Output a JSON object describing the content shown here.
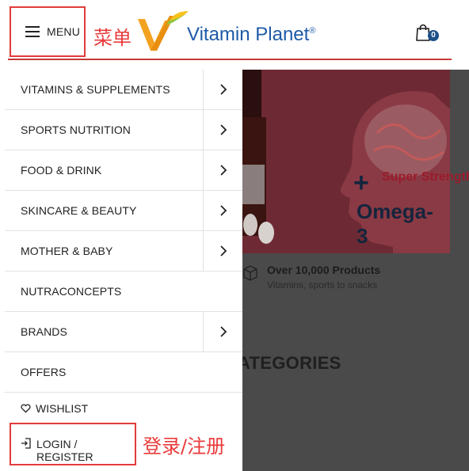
{
  "header": {
    "menu_label": "MENU",
    "menu_annotation": "菜单",
    "logo": {
      "text_vitamin": "Vitamin",
      "text_planet": "Planet",
      "reg": "®"
    },
    "cart_count": "0"
  },
  "background": {
    "hero": {
      "plus": "+",
      "super_strength": "Super Strength",
      "omega": "Omega-3"
    },
    "feature": {
      "title": "Over 10,000 Products",
      "subtitle": "Vitamins, sports to snacks"
    },
    "section_title": "ATEGORIES"
  },
  "menu": {
    "items": [
      {
        "label": "VITAMINS & SUPPLEMENTS"
      },
      {
        "label": "SPORTS NUTRITION"
      },
      {
        "label": "FOOD & DRINK"
      },
      {
        "label": "SKINCARE & BEAUTY"
      },
      {
        "label": "MOTHER & BABY"
      },
      {
        "label": "NUTRACONCEPTS"
      },
      {
        "label": "BRANDS"
      },
      {
        "label": "OFFERS"
      }
    ],
    "wishlist_label": "WISHLIST",
    "login_label": "LOGIN / REGISTER",
    "login_annotation": "登录/注册"
  },
  "colors": {
    "annotation_red": "#ea3b3b",
    "brand_blue": "#1e5aa8",
    "brand_orange": "#f5a623",
    "overlay_gray": "#4a4a4a"
  },
  "icons": [
    "hamburger-icon",
    "shopping-bag-icon",
    "chevron-right-icon",
    "heart-icon",
    "login-icon",
    "box-icon"
  ]
}
